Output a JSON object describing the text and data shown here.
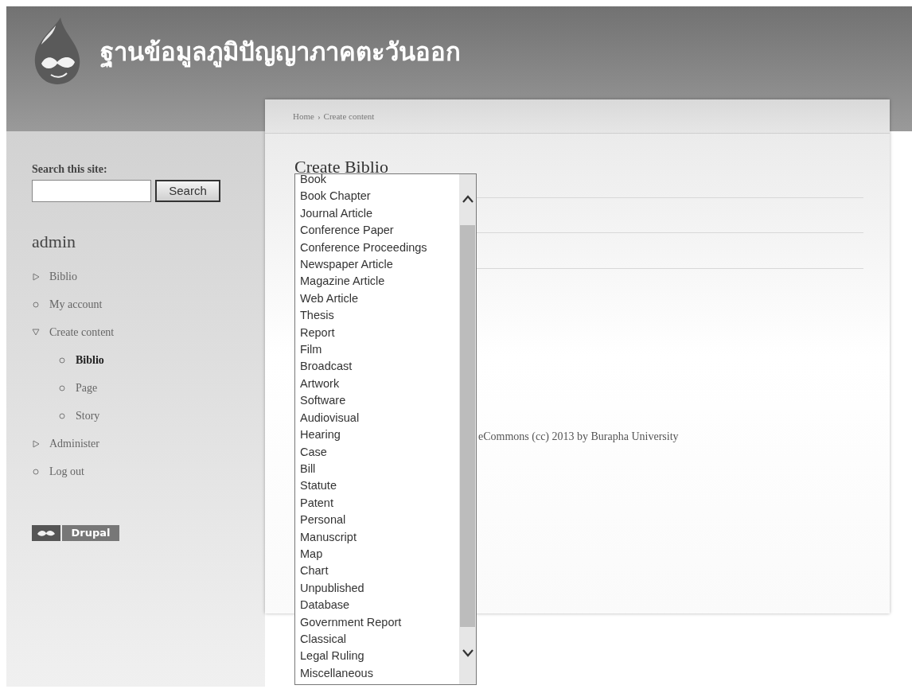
{
  "header": {
    "site_title": "ฐานข้อมูลภูมิปัญญาภาคตะวันออก"
  },
  "breadcrumb": [
    {
      "label": "Home"
    },
    {
      "label": "Create content"
    }
  ],
  "breadcrumb_separator": "›",
  "sidebar": {
    "search_label": "Search this site:",
    "search_button": "Search",
    "user_title": "admin",
    "items": [
      {
        "label": "Biblio",
        "kind": "collapsed",
        "selected": false
      },
      {
        "label": "My account",
        "kind": "leaf",
        "selected": false
      },
      {
        "label": "Create content",
        "kind": "expanded",
        "selected": false,
        "children": [
          {
            "label": "Biblio",
            "kind": "leaf",
            "selected": true
          },
          {
            "label": "Page",
            "kind": "leaf",
            "selected": false
          },
          {
            "label": "Story",
            "kind": "leaf",
            "selected": false
          }
        ]
      },
      {
        "label": "Administer",
        "kind": "collapsed",
        "selected": false
      },
      {
        "label": "Log out",
        "kind": "leaf",
        "selected": false
      }
    ],
    "badge": "Drupal"
  },
  "content": {
    "title": "Create Biblio",
    "footer": "eCommons (cc) 2013 by Burapha University"
  },
  "dropdown": {
    "options": [
      "Book",
      "Book Chapter",
      "Journal Article",
      "Conference Paper",
      "Conference Proceedings",
      "Newspaper Article",
      "Magazine Article",
      "Web Article",
      "Thesis",
      "Report",
      "Film",
      "Broadcast",
      "Artwork",
      "Software",
      "Audiovisual",
      "Hearing",
      "Case",
      "Bill",
      "Statute",
      "Patent",
      "Personal",
      "Manuscript",
      "Map",
      "Chart",
      "Unpublished",
      "Database",
      "Government Report",
      "Classical",
      "Legal Ruling",
      "Miscellaneous"
    ]
  }
}
